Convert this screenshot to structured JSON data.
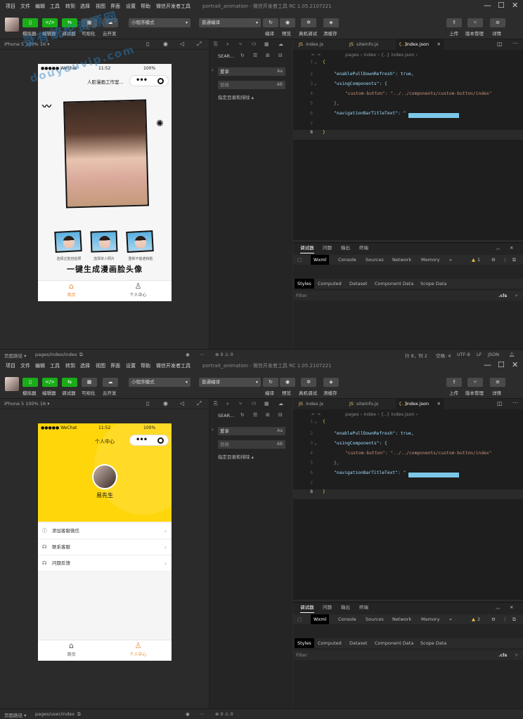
{
  "menu": {
    "items": [
      "项目",
      "文件",
      "编辑",
      "工具",
      "转到",
      "选择",
      "视图",
      "界面",
      "设置",
      "帮助",
      "微信开发者工具"
    ],
    "title_top": "portrait_animation - 微信开发者工具 RC 1.05.2107221",
    "title_bottom": "portrait_animation - 微信开发者工具 RC 1.05.2107221"
  },
  "toolbar": {
    "simulator": "模拟器",
    "editor": "编辑器",
    "debugger": "调试器",
    "visual": "可视化",
    "cloud": "云开发",
    "mode": "小程序模式",
    "compile_mode": "普通编译",
    "compile": "编译",
    "preview": "预览",
    "real_debug": "真机调试",
    "clear_cache": "清缓存",
    "upload": "上传",
    "version": "版本管理",
    "details": "详情"
  },
  "top": {
    "device": "iPhone 5 100% 16 ▾",
    "status_left": "●●●●● WeChat",
    "status_time": "11:52",
    "status_batt": "100%",
    "page_title": "人脸漫画工作室...",
    "caption1": "选择正脸自拍照",
    "caption2": "选择单人照片",
    "caption3": "重新不能遮挡脸",
    "slogan": "一键生成漫画脸头像",
    "tab_home": "首页",
    "tab_me": "个人中心",
    "path_label": "页面路径 ▾",
    "path": "pages/index/index",
    "status_issues": "⊗ 0 ⚠ 0",
    "cursor": "行 8，列 2",
    "spaces": "空格: 4",
    "encoding": "UTF-8",
    "eol": "LF",
    "lang": "JSON",
    "warnings": "1"
  },
  "bottom": {
    "device": "iPhone 5 100% 16 ▾",
    "status_left": "●●●●● WeChat",
    "status_time": "11:52",
    "status_batt": "100%",
    "page_title": "个人中心",
    "username": "易先生",
    "list": [
      "添加客服微信",
      "联系客服",
      "问题反馈"
    ],
    "tab_home": "首页",
    "tab_me": "个人中心",
    "path_label": "页面路径 ▾",
    "path": "pages/user/index",
    "status_issues": "⊗ 0 ⚠ 0",
    "warnings": "2"
  },
  "explorer": {
    "search_title": "SEAR...",
    "search_value": "爱享",
    "search_suffix": "Aa",
    "replace_placeholder": "替换",
    "replace_suffix": "AB",
    "scope": "指定目录和排除 ▴"
  },
  "editor": {
    "tabs": [
      "index.js",
      "siteinfo.js",
      "index.json"
    ],
    "tab_icons": [
      "JS",
      "JS",
      "{..}"
    ],
    "breadcrumb": "pages › index › {..} index.json ›",
    "lines": [
      {
        "n": "1",
        "text": "{"
      },
      {
        "n": "2",
        "text": "\"enablePullDownRefresh\": true,"
      },
      {
        "n": "3",
        "text": "\"usingComponents\": {"
      },
      {
        "n": "4",
        "text": "\"custom-button\": \"../../components/custom-button/index\""
      },
      {
        "n": "5",
        "text": "},"
      },
      {
        "n": "6",
        "text": "\"navigationBarTitleText\": \""
      },
      {
        "n": "7",
        "text": ""
      },
      {
        "n": "8",
        "text": "}"
      }
    ]
  },
  "devtools": {
    "top_tabs": [
      "调试器",
      "问题",
      "输出",
      "终端"
    ],
    "panels": [
      "Wxml",
      "Console",
      "Sources",
      "Network",
      "Memory",
      "»"
    ],
    "sub_tabs": [
      "Styles",
      "Computed",
      "Dataset",
      "Component Data",
      "Scope Data"
    ],
    "filter": "Filter",
    "cls": ".cls"
  },
  "watermark": {
    "line1": "录有统伦资源网",
    "line2": "douyouvip.com"
  }
}
